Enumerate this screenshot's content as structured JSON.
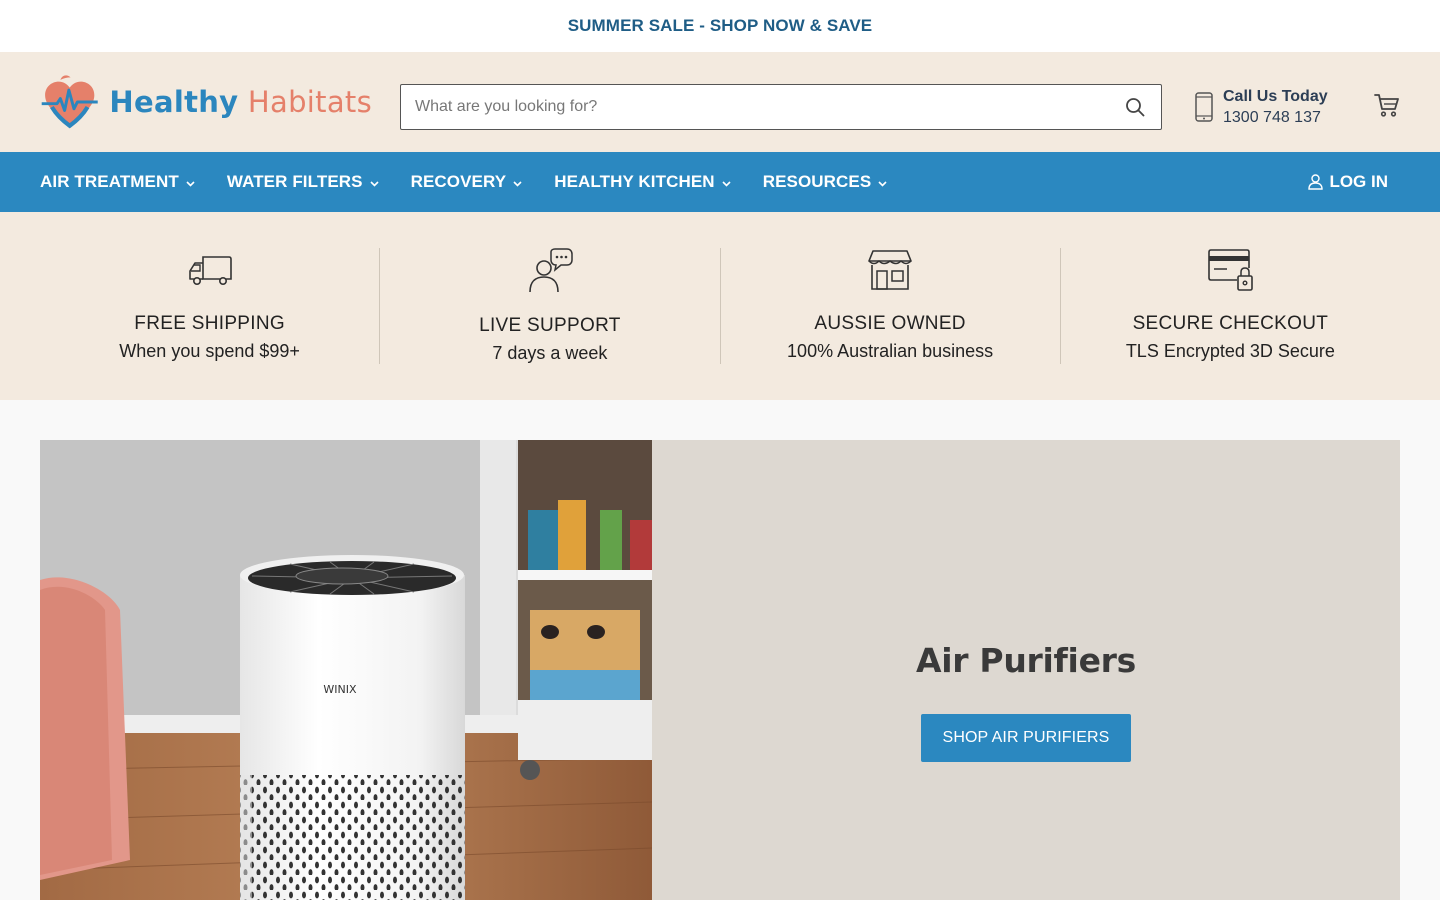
{
  "announcement": {
    "text": "SUMMER SALE - SHOP NOW & SAVE"
  },
  "brand": {
    "name_part1": "Healthy",
    "name_part2": "Habitats"
  },
  "search": {
    "placeholder": "What are you looking for?",
    "value": ""
  },
  "contact": {
    "label": "Call Us Today",
    "phone": "1300 748 137"
  },
  "nav": {
    "items": [
      {
        "label": "AIR TREATMENT"
      },
      {
        "label": "WATER FILTERS"
      },
      {
        "label": "RECOVERY"
      },
      {
        "label": "HEALTHY KITCHEN"
      },
      {
        "label": "RESOURCES"
      }
    ],
    "login_label": "LOG IN"
  },
  "features": [
    {
      "icon": "truck-icon",
      "title": "FREE SHIPPING",
      "subtitle": "When you spend $99+"
    },
    {
      "icon": "support-chat-icon",
      "title": "LIVE SUPPORT",
      "subtitle": "7 days a week"
    },
    {
      "icon": "storefront-icon",
      "title": "AUSSIE OWNED",
      "subtitle": "100% Australian business"
    },
    {
      "icon": "secure-card-icon",
      "title": "SECURE CHECKOUT",
      "subtitle": "TLS Encrypted 3D Secure"
    }
  ],
  "hero": {
    "title": "Air Purifiers",
    "button_label": "SHOP AIR PURIFIERS",
    "product_brand": "WINIX"
  },
  "colors": {
    "brand_blue": "#2b88c0",
    "brand_coral": "#e5806a",
    "header_bg": "#f3eadf",
    "announcement_text": "#1f5d86"
  }
}
